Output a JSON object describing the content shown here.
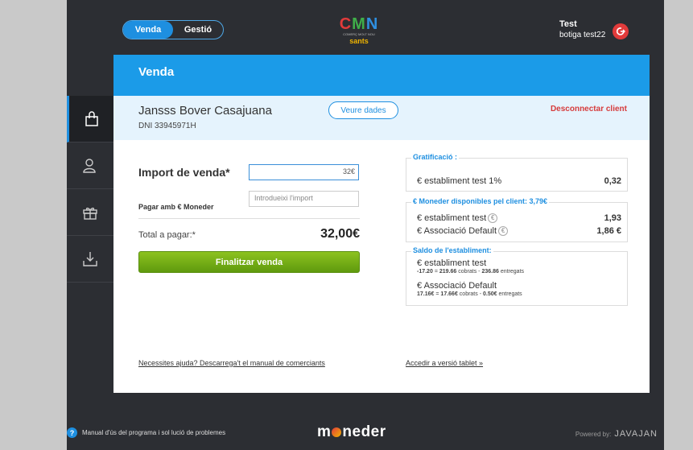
{
  "topbar": {
    "toggle": {
      "active": "Venda",
      "inactive": "Gestió"
    },
    "logo": {
      "letters": [
        "C",
        "M",
        "N"
      ],
      "subtitle": "COMERÇ MOLT NOU",
      "district": "sants"
    },
    "user": {
      "name": "Test",
      "store": "botiga test22"
    }
  },
  "sidebar": {
    "items": [
      {
        "icon": "shopping-bag-icon",
        "active": true
      },
      {
        "icon": "user-icon",
        "active": false
      },
      {
        "icon": "gift-icon",
        "active": false
      },
      {
        "icon": "download-tray-icon",
        "active": false
      }
    ]
  },
  "main": {
    "header": "Venda",
    "client": {
      "name": "Jansss Bover Casajuana",
      "dni": "DNI 33945971H",
      "view_button": "Veure dades",
      "disconnect": "Desconnectar client"
    },
    "sale": {
      "import_label": "Import de venda*",
      "import_value": "32€",
      "pay_with_label": "Pagar amb € Moneder",
      "pay_with_placeholder": "Introdueixi l'import",
      "total_label": "Total a pagar:*",
      "total_value": "32,00€",
      "finalize_button": "Finalitzar venda"
    },
    "gratificacio": {
      "title": "Gratificació :",
      "rows": [
        {
          "label": "€ establiment test 1%",
          "value": "0,32"
        }
      ]
    },
    "moneder_disponible": {
      "title": "€ Moneder disponibles pel client: 3,79€",
      "rows": [
        {
          "label": "€ establiment test",
          "value": "1,93"
        },
        {
          "label": "€ Associació Default",
          "value": "1,86 €"
        }
      ]
    },
    "saldo": {
      "title": "Saldo de l'establiment:",
      "entries": [
        {
          "label": "€ establiment test",
          "balance": "-17.20",
          "cobrats": "219.66",
          "entregats": "236.86"
        },
        {
          "label": "€ Associació Default",
          "balance": "17.16€",
          "cobrats": "17.66€",
          "entregats": "0.50€"
        }
      ],
      "eq": "=",
      "minus": "-",
      "cobrats_word": "cobrats",
      "entregats_word": "entregats"
    },
    "links": {
      "help": "Necessites ajuda? Descarrega't el manual de comerciants",
      "tablet": "Accedir a versió tablet »"
    }
  },
  "footer": {
    "help_icon": "?",
    "manual_text": "Manual d'ús del programa i sol lució de problemes",
    "brand_left": "m",
    "brand_right": "neder",
    "powered_by": "Powered by:",
    "powered_brand": "JAVAJAN"
  },
  "colors": {
    "accent": "#1b9be8",
    "frame": "#2c2e33",
    "finalize": "#6faa14",
    "danger": "#d63b3b"
  }
}
